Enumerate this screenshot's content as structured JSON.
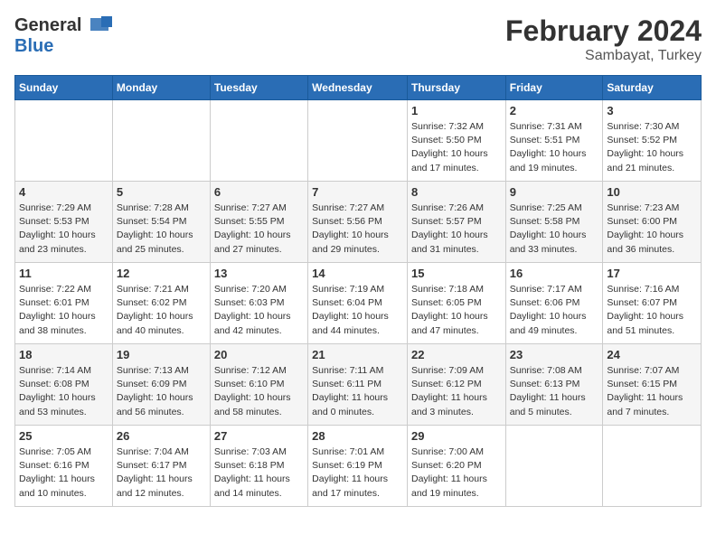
{
  "header": {
    "logo_general": "General",
    "logo_blue": "Blue",
    "title": "February 2024",
    "subtitle": "Sambayat, Turkey"
  },
  "calendar": {
    "days_of_week": [
      "Sunday",
      "Monday",
      "Tuesday",
      "Wednesday",
      "Thursday",
      "Friday",
      "Saturday"
    ],
    "weeks": [
      [
        {
          "num": "",
          "content": ""
        },
        {
          "num": "",
          "content": ""
        },
        {
          "num": "",
          "content": ""
        },
        {
          "num": "",
          "content": ""
        },
        {
          "num": "1",
          "content": "Sunrise: 7:32 AM\nSunset: 5:50 PM\nDaylight: 10 hours and 17 minutes."
        },
        {
          "num": "2",
          "content": "Sunrise: 7:31 AM\nSunset: 5:51 PM\nDaylight: 10 hours and 19 minutes."
        },
        {
          "num": "3",
          "content": "Sunrise: 7:30 AM\nSunset: 5:52 PM\nDaylight: 10 hours and 21 minutes."
        }
      ],
      [
        {
          "num": "4",
          "content": "Sunrise: 7:29 AM\nSunset: 5:53 PM\nDaylight: 10 hours and 23 minutes."
        },
        {
          "num": "5",
          "content": "Sunrise: 7:28 AM\nSunset: 5:54 PM\nDaylight: 10 hours and 25 minutes."
        },
        {
          "num": "6",
          "content": "Sunrise: 7:27 AM\nSunset: 5:55 PM\nDaylight: 10 hours and 27 minutes."
        },
        {
          "num": "7",
          "content": "Sunrise: 7:27 AM\nSunset: 5:56 PM\nDaylight: 10 hours and 29 minutes."
        },
        {
          "num": "8",
          "content": "Sunrise: 7:26 AM\nSunset: 5:57 PM\nDaylight: 10 hours and 31 minutes."
        },
        {
          "num": "9",
          "content": "Sunrise: 7:25 AM\nSunset: 5:58 PM\nDaylight: 10 hours and 33 minutes."
        },
        {
          "num": "10",
          "content": "Sunrise: 7:23 AM\nSunset: 6:00 PM\nDaylight: 10 hours and 36 minutes."
        }
      ],
      [
        {
          "num": "11",
          "content": "Sunrise: 7:22 AM\nSunset: 6:01 PM\nDaylight: 10 hours and 38 minutes."
        },
        {
          "num": "12",
          "content": "Sunrise: 7:21 AM\nSunset: 6:02 PM\nDaylight: 10 hours and 40 minutes."
        },
        {
          "num": "13",
          "content": "Sunrise: 7:20 AM\nSunset: 6:03 PM\nDaylight: 10 hours and 42 minutes."
        },
        {
          "num": "14",
          "content": "Sunrise: 7:19 AM\nSunset: 6:04 PM\nDaylight: 10 hours and 44 minutes."
        },
        {
          "num": "15",
          "content": "Sunrise: 7:18 AM\nSunset: 6:05 PM\nDaylight: 10 hours and 47 minutes."
        },
        {
          "num": "16",
          "content": "Sunrise: 7:17 AM\nSunset: 6:06 PM\nDaylight: 10 hours and 49 minutes."
        },
        {
          "num": "17",
          "content": "Sunrise: 7:16 AM\nSunset: 6:07 PM\nDaylight: 10 hours and 51 minutes."
        }
      ],
      [
        {
          "num": "18",
          "content": "Sunrise: 7:14 AM\nSunset: 6:08 PM\nDaylight: 10 hours and 53 minutes."
        },
        {
          "num": "19",
          "content": "Sunrise: 7:13 AM\nSunset: 6:09 PM\nDaylight: 10 hours and 56 minutes."
        },
        {
          "num": "20",
          "content": "Sunrise: 7:12 AM\nSunset: 6:10 PM\nDaylight: 10 hours and 58 minutes."
        },
        {
          "num": "21",
          "content": "Sunrise: 7:11 AM\nSunset: 6:11 PM\nDaylight: 11 hours and 0 minutes."
        },
        {
          "num": "22",
          "content": "Sunrise: 7:09 AM\nSunset: 6:12 PM\nDaylight: 11 hours and 3 minutes."
        },
        {
          "num": "23",
          "content": "Sunrise: 7:08 AM\nSunset: 6:13 PM\nDaylight: 11 hours and 5 minutes."
        },
        {
          "num": "24",
          "content": "Sunrise: 7:07 AM\nSunset: 6:15 PM\nDaylight: 11 hours and 7 minutes."
        }
      ],
      [
        {
          "num": "25",
          "content": "Sunrise: 7:05 AM\nSunset: 6:16 PM\nDaylight: 11 hours and 10 minutes."
        },
        {
          "num": "26",
          "content": "Sunrise: 7:04 AM\nSunset: 6:17 PM\nDaylight: 11 hours and 12 minutes."
        },
        {
          "num": "27",
          "content": "Sunrise: 7:03 AM\nSunset: 6:18 PM\nDaylight: 11 hours and 14 minutes."
        },
        {
          "num": "28",
          "content": "Sunrise: 7:01 AM\nSunset: 6:19 PM\nDaylight: 11 hours and 17 minutes."
        },
        {
          "num": "29",
          "content": "Sunrise: 7:00 AM\nSunset: 6:20 PM\nDaylight: 11 hours and 19 minutes."
        },
        {
          "num": "",
          "content": ""
        },
        {
          "num": "",
          "content": ""
        }
      ]
    ]
  }
}
